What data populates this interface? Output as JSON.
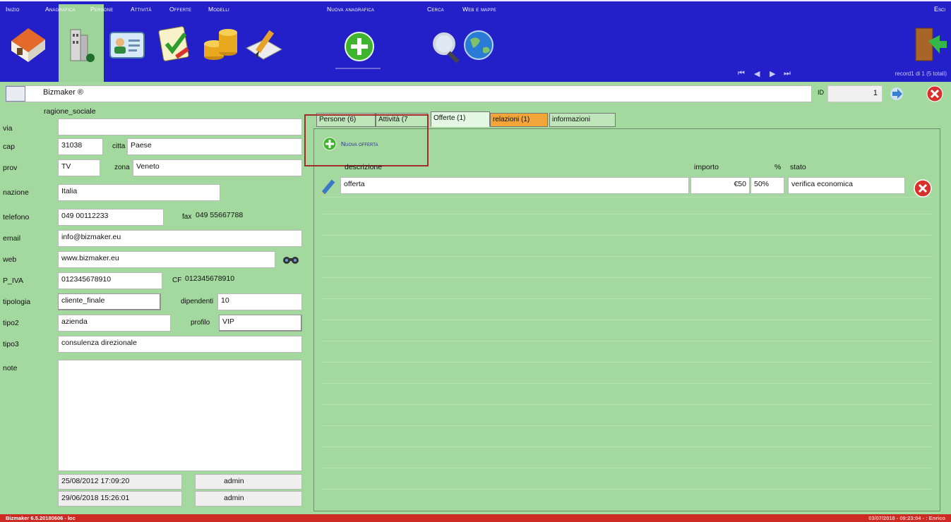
{
  "toolbar": {
    "items": [
      {
        "label": "Inizio",
        "icon": "home-icon"
      },
      {
        "label": "Anagrafica",
        "icon": "building-icon"
      },
      {
        "label": "Persone",
        "icon": "contact-card-icon"
      },
      {
        "label": "Attività",
        "icon": "checklist-icon"
      },
      {
        "label": "Offerte",
        "icon": "coins-icon"
      },
      {
        "label": "Modelli",
        "icon": "pen-icon"
      },
      {
        "label": "Nuova anagrafica",
        "icon": "add-circle-icon"
      },
      {
        "label": "Cerca",
        "icon": "magnifier-icon"
      },
      {
        "label": "Web e mappe",
        "icon": "globe-icon"
      }
    ],
    "exit_label": "Esci",
    "record_counter": "record1 di 1 (5 totali)",
    "active_color": "#9ed39a",
    "bar_color": "#2320c9"
  },
  "record": {
    "title": "Bizmaker ®",
    "id_label": "ID",
    "id_value": "1"
  },
  "form": {
    "ragione_label": "ragione_sociale",
    "via_label": "via",
    "via_value": "",
    "cap_label": "cap",
    "cap_value": "31038",
    "citta_label": "citta",
    "citta_value": "Paese",
    "prov_label": "prov",
    "prov_value": "TV",
    "zona_label": "zona",
    "zona_value": "Veneto",
    "nazione_label": "nazione",
    "nazione_value": "Italia",
    "telefono_label": "telefono",
    "telefono_value": "049 00112233",
    "fax_label": "fax",
    "fax_value": "049 55667788",
    "email_label": "email",
    "email_value": "info@bizmaker.eu",
    "web_label": "web",
    "web_value": "www.bizmaker.eu",
    "piva_label": "P_IVA",
    "piva_value": "012345678910",
    "cf_label": "CF",
    "cf_value": "012345678910",
    "tipologia_label": "tipologia",
    "tipologia_value": "cliente_finale",
    "dipendenti_label": "dipendenti",
    "dipendenti_value": "10",
    "tipo2_label": "tipo2",
    "tipo2_value": "azienda",
    "profilo_label": "profilo",
    "profilo_value": "VIP",
    "tipo3_label": "tipo3",
    "tipo3_value": "consulenza direzionale",
    "note_label": "note",
    "note_value": "",
    "created_date": "25/08/2012 17:09:20",
    "created_user": "admin",
    "modified_date": "29/06/2018 15:26:01",
    "modified_user": "admin"
  },
  "tabs": [
    {
      "label": "Persone (6)"
    },
    {
      "label": "Attività (7"
    },
    {
      "label": "Offerte (1)"
    },
    {
      "label": "relazioni (1)"
    },
    {
      "label": "informazioni"
    }
  ],
  "offerte": {
    "new_label": "Nuova offerta",
    "headers": {
      "descrizione": "descrizione",
      "importo": "importo",
      "percent": "%",
      "stato": "stato"
    },
    "rows": [
      {
        "descrizione": "offerta",
        "importo": "€50",
        "percent": "50%",
        "stato": "verifica economica"
      }
    ]
  },
  "status": {
    "left": "Bizmaker 6.5.20180606 - loc",
    "right": "03/07/2018 - 09:23:04 - : Enrico"
  }
}
